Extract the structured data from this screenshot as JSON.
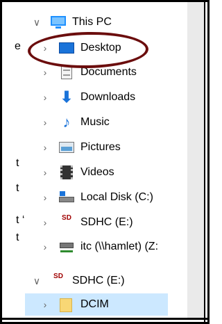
{
  "background_fragments": [
    "e",
    "t",
    "t",
    "t ‘",
    "t"
  ],
  "tree": {
    "this_pc": "This PC",
    "desktop": "Desktop",
    "documents": "Documents",
    "downloads": "Downloads",
    "music": "Music",
    "pictures": "Pictures",
    "videos": "Videos",
    "local_disk": "Local Disk (C:)",
    "sdhc_child": "SDHC (E:)",
    "network_drive": "itc (\\\\hamlet) (Z:",
    "sdhc_root": "SDHC (E:)",
    "dcim": "DCIM"
  },
  "glyphs": {
    "expanded": "∨",
    "collapsed": "›",
    "downloads_icon": "⬇",
    "music_icon": "♪",
    "sd_icon": "SD"
  },
  "colors": {
    "highlight_oval": "#6b0d0d",
    "selected_row": "#cce8ff",
    "accent": "#1a73d9"
  }
}
